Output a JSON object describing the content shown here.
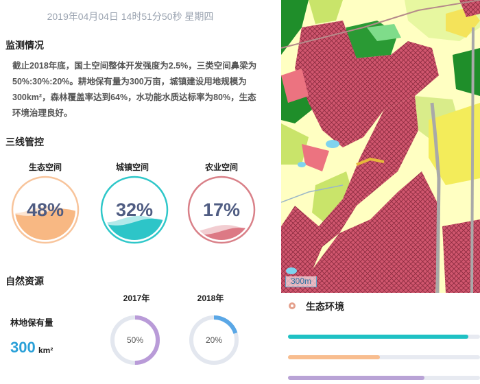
{
  "header": {
    "datetime": "2019年04月04日 14时51分50秒 星期四"
  },
  "monitoring": {
    "title": "监测情况",
    "paragraph": "截止2018年底，国土空间整体开发强度为2.5%，三类空间鼻梁为50%:30%:20%。耕地保有量为300万亩，城镇建设用地规模为300km²，森林覆盖率达到64%，水功能水质达标率为80%，生态环境治理良好。"
  },
  "three_lines": {
    "title": "三线管控",
    "gauges": [
      {
        "label": "生态空间",
        "value_text": "48%",
        "fraction": 0.48,
        "color": "#f7b27a",
        "ring": "#f8c49b"
      },
      {
        "label": "城镇空间",
        "value_text": "32%",
        "fraction": 0.32,
        "color": "#1fc1c4",
        "ring": "#2ec7c9"
      },
      {
        "label": "农业空间",
        "value_text": "17%",
        "fraction": 0.17,
        "color": "#d9707c",
        "ring": "#d98088"
      }
    ]
  },
  "natural_resources": {
    "title": "自然资源",
    "label": "林地保有量",
    "value": "300",
    "unit": "km²",
    "years": [
      {
        "year": "2017年",
        "value_text": "50%",
        "fraction": 0.5,
        "color": "#b99bd8"
      },
      {
        "year": "2018年",
        "value_text": "20%",
        "fraction": 0.2,
        "color": "#5aa7e6"
      }
    ]
  },
  "map": {
    "scale_label": "300m"
  },
  "eco": {
    "title": "生态环境",
    "bars": [
      {
        "name": "bar-1",
        "fraction": 0.94,
        "color": "#1fc1c4"
      },
      {
        "name": "bar-2",
        "fraction": 0.48,
        "color": "#f8bd8f"
      },
      {
        "name": "bar-3",
        "fraction": 0.71,
        "color": "#b9a3d6"
      }
    ]
  }
}
